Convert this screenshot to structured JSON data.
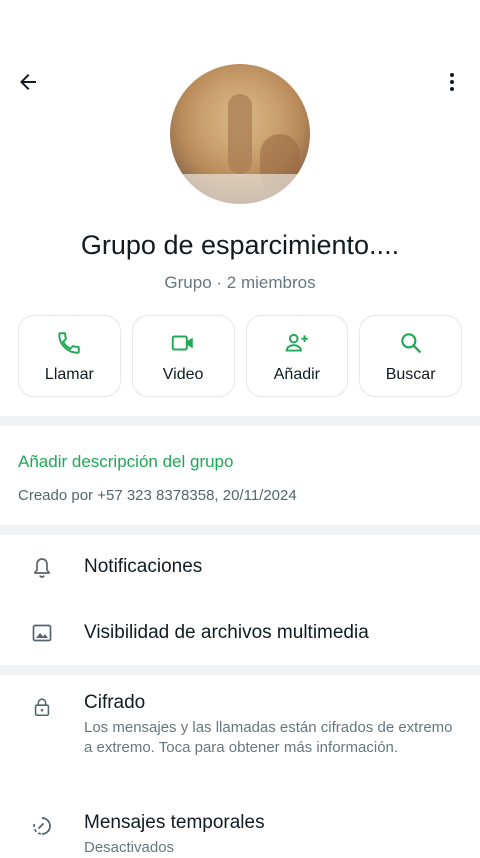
{
  "header": {
    "group_name": "Grupo de esparcimiento....",
    "group_meta": "Grupo · 2 miembros"
  },
  "actions": [
    {
      "label": "Llamar",
      "icon": "phone-icon"
    },
    {
      "label": "Video",
      "icon": "video-icon"
    },
    {
      "label": "Añadir",
      "icon": "add-person-icon"
    },
    {
      "label": "Buscar",
      "icon": "search-icon"
    }
  ],
  "description": {
    "add_label": "Añadir descripción del grupo",
    "created_by": "Creado por +57 323 8378358, 20/11/2024"
  },
  "settings": {
    "notifications": "Notificaciones",
    "media_visibility": "Visibilidad de archivos multimedia"
  },
  "privacy": {
    "encryption_title": "Cifrado",
    "encryption_sub": "Los mensajes y las llamadas están cifrados de extremo a extremo. Toca para obtener más información.",
    "temp_title": "Mensajes temporales",
    "temp_sub": "Desactivados"
  },
  "colors": {
    "accent": "#1fa855",
    "divider": "#f0f2f5"
  }
}
